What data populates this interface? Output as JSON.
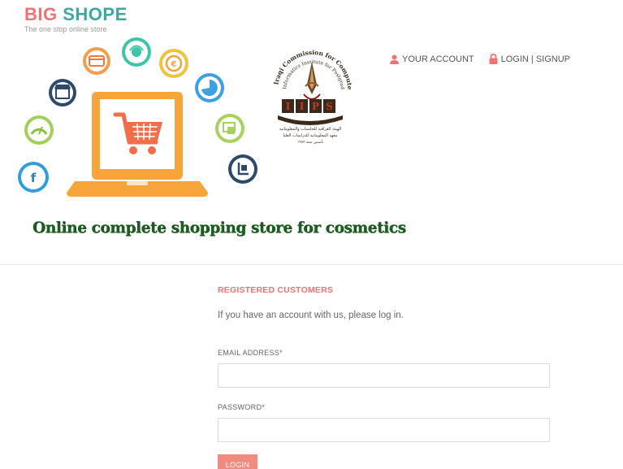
{
  "header": {
    "logo_part1": "BIG",
    "logo_part2": "SHOPE",
    "tagline": "The one stop online store"
  },
  "nav": {
    "account_label": "YOUR ACCOUNT",
    "login_label": "LOGIN | SIGNUP"
  },
  "seal": {
    "arc_text": "Iraqi Commission for Computers & Informatics",
    "arc_text2": "Informatics Institute for Postgraduate Studies",
    "letters": [
      "I",
      "I",
      "P",
      "S"
    ],
    "arabic_line1": "الهيئة العراقية للحاسبات والمعلوماتية",
    "arabic_line2": "معهد المعلوماتية للدراسات العليا",
    "arabic_line3": "تأسس سنة ١٩٧٢"
  },
  "banner_heading": "Online complete shopping store for cosmetics",
  "login": {
    "title": "REGISTERED CUSTOMERS",
    "intro": "If you have an account with us, please log in.",
    "email_label": "EMAIL ADDRESS*",
    "email_value": "",
    "password_label": "PASSWORD*",
    "password_value": "",
    "button_label": "LOGIN"
  },
  "colors": {
    "brand_red": "#f07373",
    "brand_teal": "#3ca8a2",
    "login_button": "#f18a7f",
    "heading_green": "#1b5e20"
  },
  "icons": [
    "cart-icon",
    "laptop-icon",
    "card-icon",
    "support-icon",
    "euro-icon",
    "store-icon",
    "pie-chart-icon",
    "speedometer-icon",
    "window-icon",
    "social-icon",
    "delivery-icon",
    "user-icon",
    "lock-icon"
  ]
}
